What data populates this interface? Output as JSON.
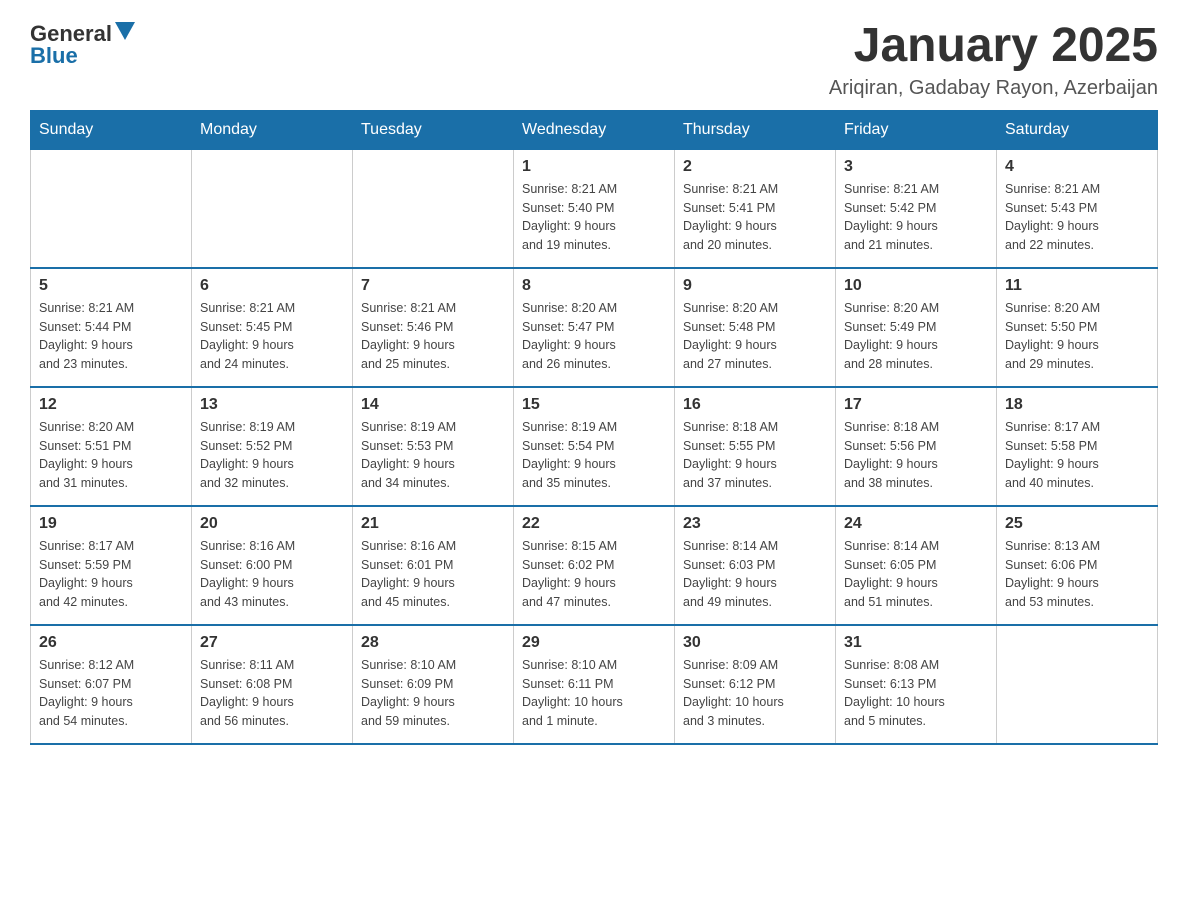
{
  "logo": {
    "text_general": "General",
    "text_blue": "Blue"
  },
  "header": {
    "title": "January 2025",
    "subtitle": "Ariqiran, Gadabay Rayon, Azerbaijan"
  },
  "weekdays": [
    "Sunday",
    "Monday",
    "Tuesday",
    "Wednesday",
    "Thursday",
    "Friday",
    "Saturday"
  ],
  "weeks": [
    [
      {
        "day": "",
        "info": ""
      },
      {
        "day": "",
        "info": ""
      },
      {
        "day": "",
        "info": ""
      },
      {
        "day": "1",
        "info": "Sunrise: 8:21 AM\nSunset: 5:40 PM\nDaylight: 9 hours\nand 19 minutes."
      },
      {
        "day": "2",
        "info": "Sunrise: 8:21 AM\nSunset: 5:41 PM\nDaylight: 9 hours\nand 20 minutes."
      },
      {
        "day": "3",
        "info": "Sunrise: 8:21 AM\nSunset: 5:42 PM\nDaylight: 9 hours\nand 21 minutes."
      },
      {
        "day": "4",
        "info": "Sunrise: 8:21 AM\nSunset: 5:43 PM\nDaylight: 9 hours\nand 22 minutes."
      }
    ],
    [
      {
        "day": "5",
        "info": "Sunrise: 8:21 AM\nSunset: 5:44 PM\nDaylight: 9 hours\nand 23 minutes."
      },
      {
        "day": "6",
        "info": "Sunrise: 8:21 AM\nSunset: 5:45 PM\nDaylight: 9 hours\nand 24 minutes."
      },
      {
        "day": "7",
        "info": "Sunrise: 8:21 AM\nSunset: 5:46 PM\nDaylight: 9 hours\nand 25 minutes."
      },
      {
        "day": "8",
        "info": "Sunrise: 8:20 AM\nSunset: 5:47 PM\nDaylight: 9 hours\nand 26 minutes."
      },
      {
        "day": "9",
        "info": "Sunrise: 8:20 AM\nSunset: 5:48 PM\nDaylight: 9 hours\nand 27 minutes."
      },
      {
        "day": "10",
        "info": "Sunrise: 8:20 AM\nSunset: 5:49 PM\nDaylight: 9 hours\nand 28 minutes."
      },
      {
        "day": "11",
        "info": "Sunrise: 8:20 AM\nSunset: 5:50 PM\nDaylight: 9 hours\nand 29 minutes."
      }
    ],
    [
      {
        "day": "12",
        "info": "Sunrise: 8:20 AM\nSunset: 5:51 PM\nDaylight: 9 hours\nand 31 minutes."
      },
      {
        "day": "13",
        "info": "Sunrise: 8:19 AM\nSunset: 5:52 PM\nDaylight: 9 hours\nand 32 minutes."
      },
      {
        "day": "14",
        "info": "Sunrise: 8:19 AM\nSunset: 5:53 PM\nDaylight: 9 hours\nand 34 minutes."
      },
      {
        "day": "15",
        "info": "Sunrise: 8:19 AM\nSunset: 5:54 PM\nDaylight: 9 hours\nand 35 minutes."
      },
      {
        "day": "16",
        "info": "Sunrise: 8:18 AM\nSunset: 5:55 PM\nDaylight: 9 hours\nand 37 minutes."
      },
      {
        "day": "17",
        "info": "Sunrise: 8:18 AM\nSunset: 5:56 PM\nDaylight: 9 hours\nand 38 minutes."
      },
      {
        "day": "18",
        "info": "Sunrise: 8:17 AM\nSunset: 5:58 PM\nDaylight: 9 hours\nand 40 minutes."
      }
    ],
    [
      {
        "day": "19",
        "info": "Sunrise: 8:17 AM\nSunset: 5:59 PM\nDaylight: 9 hours\nand 42 minutes."
      },
      {
        "day": "20",
        "info": "Sunrise: 8:16 AM\nSunset: 6:00 PM\nDaylight: 9 hours\nand 43 minutes."
      },
      {
        "day": "21",
        "info": "Sunrise: 8:16 AM\nSunset: 6:01 PM\nDaylight: 9 hours\nand 45 minutes."
      },
      {
        "day": "22",
        "info": "Sunrise: 8:15 AM\nSunset: 6:02 PM\nDaylight: 9 hours\nand 47 minutes."
      },
      {
        "day": "23",
        "info": "Sunrise: 8:14 AM\nSunset: 6:03 PM\nDaylight: 9 hours\nand 49 minutes."
      },
      {
        "day": "24",
        "info": "Sunrise: 8:14 AM\nSunset: 6:05 PM\nDaylight: 9 hours\nand 51 minutes."
      },
      {
        "day": "25",
        "info": "Sunrise: 8:13 AM\nSunset: 6:06 PM\nDaylight: 9 hours\nand 53 minutes."
      }
    ],
    [
      {
        "day": "26",
        "info": "Sunrise: 8:12 AM\nSunset: 6:07 PM\nDaylight: 9 hours\nand 54 minutes."
      },
      {
        "day": "27",
        "info": "Sunrise: 8:11 AM\nSunset: 6:08 PM\nDaylight: 9 hours\nand 56 minutes."
      },
      {
        "day": "28",
        "info": "Sunrise: 8:10 AM\nSunset: 6:09 PM\nDaylight: 9 hours\nand 59 minutes."
      },
      {
        "day": "29",
        "info": "Sunrise: 8:10 AM\nSunset: 6:11 PM\nDaylight: 10 hours\nand 1 minute."
      },
      {
        "day": "30",
        "info": "Sunrise: 8:09 AM\nSunset: 6:12 PM\nDaylight: 10 hours\nand 3 minutes."
      },
      {
        "day": "31",
        "info": "Sunrise: 8:08 AM\nSunset: 6:13 PM\nDaylight: 10 hours\nand 5 minutes."
      },
      {
        "day": "",
        "info": ""
      }
    ]
  ]
}
